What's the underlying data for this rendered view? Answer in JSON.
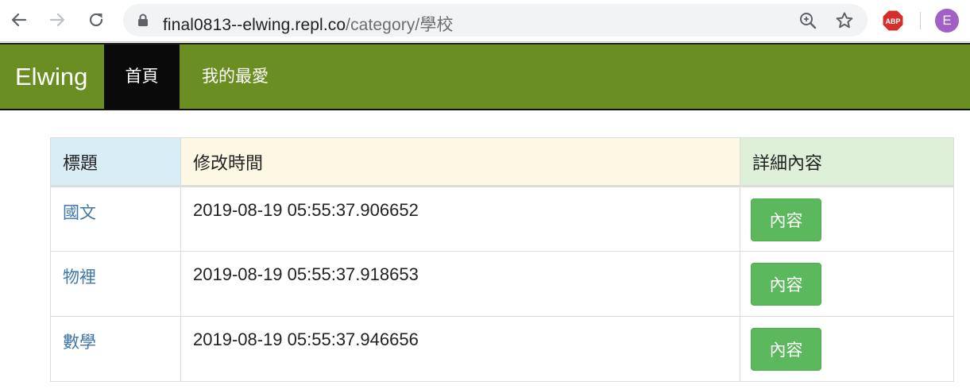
{
  "browser": {
    "url_host": "final0813--elwing.repl.co",
    "url_path": "/category/學校",
    "profile_initial": "E",
    "extension_label": "ABP",
    "icons": [
      "back-arrow-icon",
      "forward-arrow-icon",
      "reload-icon",
      "lock-icon",
      "zoom-icon",
      "star-icon",
      "adblock-icon"
    ]
  },
  "navbar": {
    "brand": "Elwing",
    "items": [
      {
        "label": "首頁",
        "active": true
      },
      {
        "label": "我的最愛",
        "active": false
      }
    ]
  },
  "table": {
    "headers": [
      "標題",
      "修改時間",
      "詳細內容"
    ],
    "rows": [
      {
        "title": "國文",
        "modified": "2019-08-19 05:55:37.906652",
        "action": "內容"
      },
      {
        "title": "物裡",
        "modified": "2019-08-19 05:55:37.918653",
        "action": "內容"
      },
      {
        "title": "數學",
        "modified": "2019-08-19 05:55:37.946656",
        "action": "內容"
      }
    ]
  },
  "colors": {
    "navbar_bg": "#6b8e23",
    "active_nav_bg": "#0a0a0a",
    "header_title_bg": "#d9edf7",
    "header_time_bg": "#fcf8e3",
    "header_detail_bg": "#dff0d8",
    "button_bg": "#5cb85c",
    "link_color": "#3f76a8",
    "avatar_bg": "#a25fc6"
  }
}
